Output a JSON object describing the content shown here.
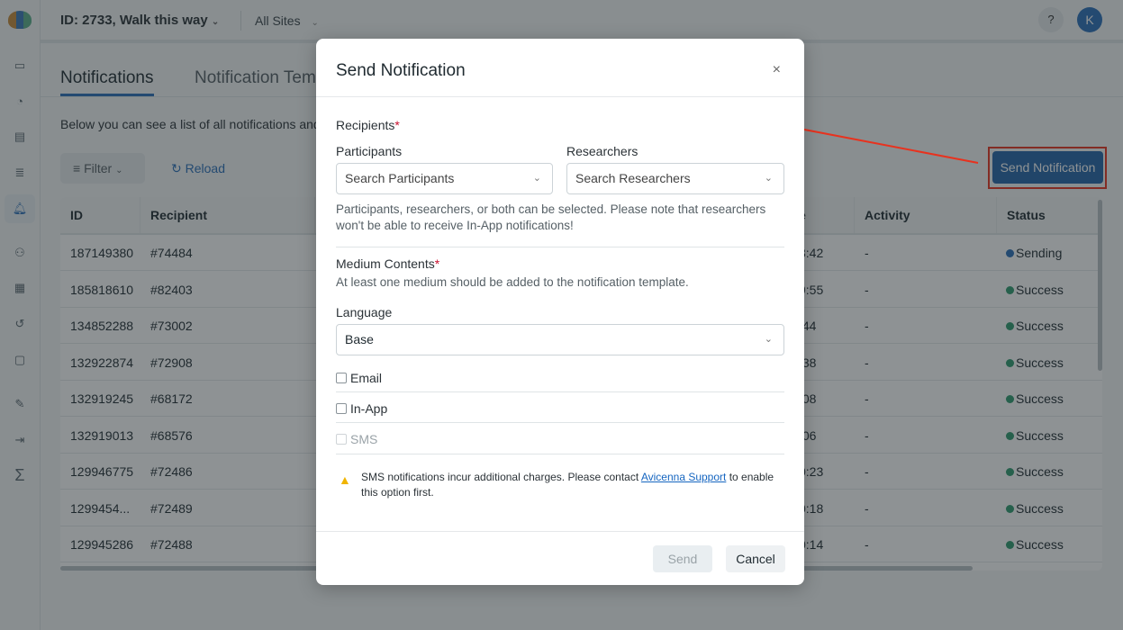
{
  "topbar": {
    "project": "ID: 2733, Walk this way",
    "sites": "All Sites",
    "help": "?",
    "avatar": "K"
  },
  "tabs": [
    "Notifications",
    "Notification Tem"
  ],
  "description": "Below you can see a list of all notifications and th",
  "toolbar": {
    "filter": "Filter",
    "reload": "Reload",
    "send": "Send Notification"
  },
  "table": {
    "headers": [
      "ID",
      "Recipient",
      "e",
      "Activity",
      "Status"
    ],
    "rows": [
      {
        "id": "187149380",
        "recipient": "#74484",
        "time": "3:42",
        "activity": "-",
        "status": "Sending"
      },
      {
        "id": "185818610",
        "recipient": "#82403",
        "time": "9:55",
        "activity": "-",
        "status": "Success"
      },
      {
        "id": "134852288",
        "recipient": "#73002",
        "time": ":44",
        "activity": "-",
        "status": "Success"
      },
      {
        "id": "132922874",
        "recipient": "#72908",
        "time": ":38",
        "activity": "-",
        "status": "Success"
      },
      {
        "id": "132919245",
        "recipient": "#68172",
        "time": ":08",
        "activity": "-",
        "status": "Success"
      },
      {
        "id": "132919013",
        "recipient": "#68576",
        "time": ":06",
        "activity": "-",
        "status": "Success"
      },
      {
        "id": "129946775",
        "recipient": "#72486",
        "time": "0:23",
        "activity": "-",
        "status": "Success"
      },
      {
        "id": "1299454...",
        "recipient": "#72489",
        "time": "0:18",
        "activity": "-",
        "status": "Success"
      },
      {
        "id": "129945286",
        "recipient": "#72488",
        "time": "0:14",
        "activity": "-",
        "status": "Success"
      }
    ]
  },
  "colors": {
    "Sending": "#2a6fb8",
    "Success": "#2e9a6e",
    "accent": "#2565a8",
    "annotation": "#e8321e"
  },
  "modal": {
    "title": "Send Notification",
    "close": "×",
    "recipients_label": "Recipients",
    "participants_label": "Participants",
    "participants_placeholder": "Search Participants",
    "researchers_label": "Researchers",
    "researchers_placeholder": "Search Researchers",
    "recipients_help": "Participants, researchers, or both can be selected. Please note that researchers won't be able to receive In-App notifications!",
    "medium_label": "Medium Contents",
    "medium_help": "At least one medium should be added to the notification template.",
    "language_label": "Language",
    "language_value": "Base",
    "email": "Email",
    "inapp": "In-App",
    "sms": "SMS",
    "warn_pre": "SMS notifications incur additional charges. Please contact ",
    "warn_link": "Avicenna Support",
    "warn_post": " to enable this option first.",
    "send": "Send",
    "cancel": "Cancel"
  }
}
